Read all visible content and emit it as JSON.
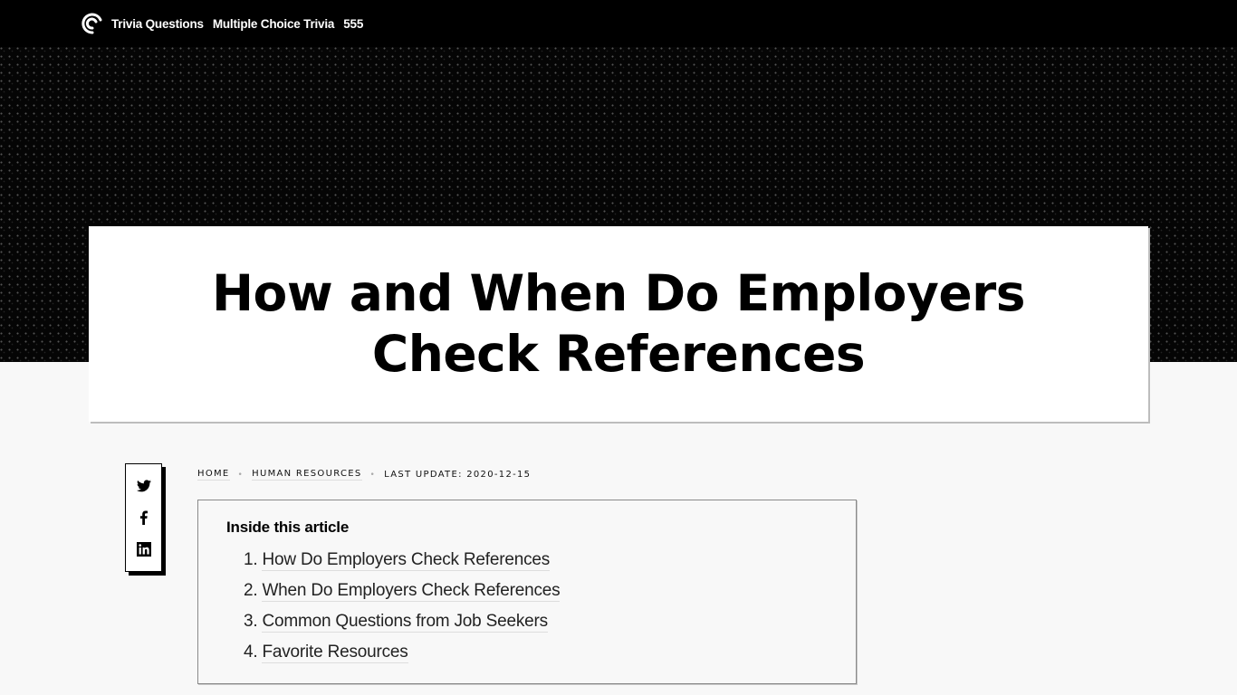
{
  "header": {
    "logo_icon": "spiral-logo-icon",
    "nav": [
      {
        "label": "Trivia Questions"
      },
      {
        "label": "Multiple Choice Trivia"
      },
      {
        "label": "555"
      }
    ]
  },
  "article": {
    "title": "How and When Do Employers Check References"
  },
  "share": {
    "items": [
      {
        "icon": "twitter-icon",
        "label": "Twitter"
      },
      {
        "icon": "facebook-icon",
        "label": "Facebook"
      },
      {
        "icon": "linkedin-icon",
        "label": "LinkedIn"
      }
    ]
  },
  "breadcrumb": {
    "items": [
      {
        "label": "HOME"
      },
      {
        "label": "HUMAN RESOURCES"
      }
    ],
    "separator": "•",
    "last_update": "LAST UPDATE: 2020-12-15"
  },
  "toc": {
    "title": "Inside this article",
    "items": [
      {
        "num": "1.",
        "label": "How Do Employers Check References"
      },
      {
        "num": "2.",
        "label": "When Do Employers Check References"
      },
      {
        "num": "3.",
        "label": "Common Questions from Job Seekers"
      },
      {
        "num": "4.",
        "label": "Favorite Resources"
      }
    ]
  },
  "colors": {
    "header_bg": "#000000",
    "page_bg": "#f8f8f8",
    "card_bg": "#ffffff",
    "text": "#000000"
  }
}
